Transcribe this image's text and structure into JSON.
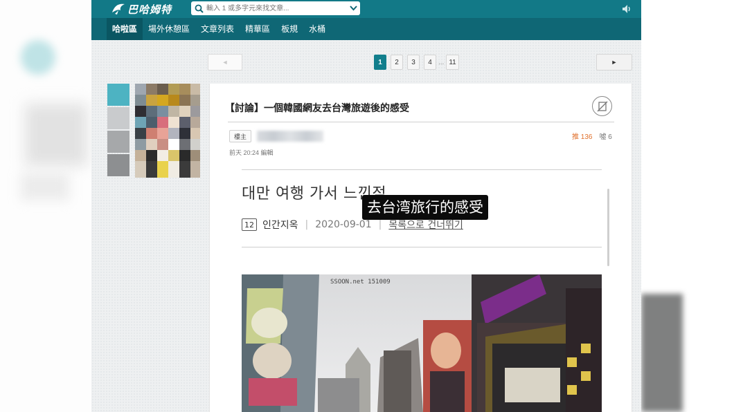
{
  "site": {
    "logo_text": "巴哈姆特",
    "search_placeholder": "輸入 1 或多字元來找文章..."
  },
  "nav": {
    "items": [
      {
        "label": "哈啦區",
        "active": true
      },
      {
        "label": "場外休憩區",
        "active": false
      },
      {
        "label": "文章列表",
        "active": false
      },
      {
        "label": "精華區",
        "active": false
      },
      {
        "label": "板規",
        "active": false
      },
      {
        "label": "水桶",
        "active": false
      }
    ]
  },
  "pagination": {
    "prev": "◄",
    "next": "►",
    "pages": [
      "1",
      "2",
      "3",
      "4"
    ],
    "ellipsis": "...",
    "last": "11",
    "current": "1"
  },
  "post": {
    "title": "【討論】一個韓國網友去台灣旅遊後的感受",
    "role": "樓主",
    "time": "前天 20:24 編輯",
    "gp": "推 136",
    "bp": "噓 6"
  },
  "article": {
    "title": "대만 여행 가서 느낀점",
    "level": "12",
    "author": "인간지옥",
    "separator": "|",
    "date": "2020-09-01",
    "back": "목록으로 건너뛰기",
    "caption": "去台湾旅行的感受",
    "watermark": "SSOON.net 151009"
  },
  "colors": {
    "topbar": "#127987",
    "navbar": "#0f6775",
    "accent": "#117e8c",
    "gp": "#e0702c"
  },
  "icons": {
    "search": "search-icon",
    "dropdown": "chevron-down-icon",
    "speaker": "speaker-icon",
    "no_ad": "no-ad-icon"
  }
}
